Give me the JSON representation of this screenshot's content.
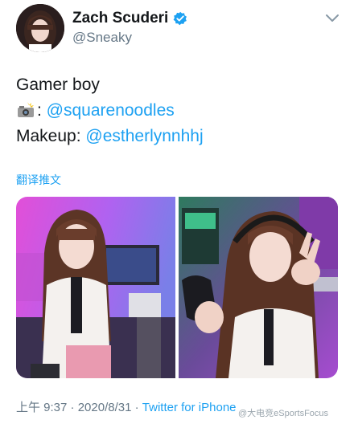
{
  "author": {
    "display_name": "Zach Scuderi",
    "handle": "@Sneaky",
    "verified_icon": "verified-badge-icon",
    "menu_icon": "chevron-down-icon"
  },
  "tweet": {
    "line1": "Gamer boy",
    "line2_emoji": "camera-flash-icon",
    "line2_sep": ": ",
    "line2_mention": "@squarenoodles",
    "line3_prefix": "Makeup: ",
    "line3_mention": "@estherlynnhhj"
  },
  "translate_label": "翻译推文",
  "meta": {
    "time": "上午 9:37",
    "sep1": " · ",
    "date": "2020/8/31",
    "sep2": " · ",
    "source": "Twitter for iPhone"
  },
  "watermark": "@大电竞eSportsFocus",
  "colors": {
    "link": "#1da1f2",
    "secondary_text": "#657786",
    "primary_text": "#14171a"
  }
}
